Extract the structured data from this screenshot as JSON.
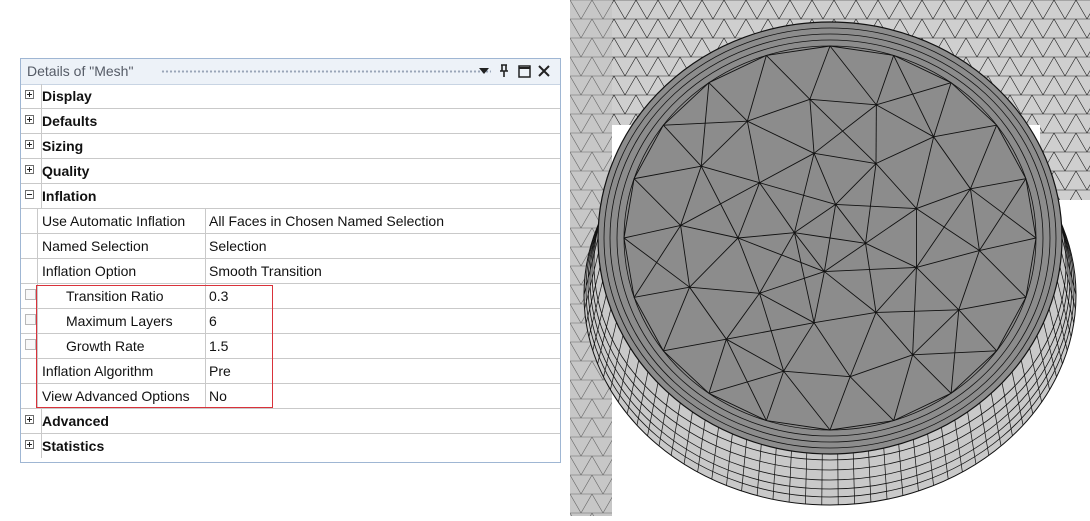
{
  "panel": {
    "title": "Details of \"Mesh\"",
    "header_buttons": [
      "dropdown-arrow-icon",
      "pin-icon",
      "maximize-icon",
      "close-icon"
    ],
    "groups_top": [
      {
        "label": "Display",
        "state": "collapsed"
      },
      {
        "label": "Defaults",
        "state": "collapsed"
      },
      {
        "label": "Sizing",
        "state": "collapsed"
      },
      {
        "label": "Quality",
        "state": "collapsed"
      }
    ],
    "inflation": {
      "label": "Inflation",
      "state": "expanded",
      "properties": [
        {
          "name": "Use Automatic Inflation",
          "value": "All Faces in Chosen Named Selection",
          "checkbox": false
        },
        {
          "name": "Named Selection",
          "value": "Selection",
          "checkbox": false
        },
        {
          "name": "Inflation Option",
          "value": "Smooth Transition",
          "checkbox": false
        },
        {
          "name": "Transition Ratio",
          "value": "0.3",
          "checkbox": true
        },
        {
          "name": "Maximum Layers",
          "value": "6",
          "checkbox": true
        },
        {
          "name": "Growth Rate",
          "value": "1.5",
          "checkbox": true
        },
        {
          "name": "Inflation Algorithm",
          "value": "Pre",
          "checkbox": false
        },
        {
          "name": "View Advanced Options",
          "value": "No",
          "checkbox": false
        }
      ]
    },
    "groups_bottom": [
      {
        "label": "Advanced",
        "state": "collapsed"
      },
      {
        "label": "Statistics",
        "state": "collapsed"
      }
    ]
  },
  "colors": {
    "panel_border": "#9fb6d3",
    "highlight_border": "#d9323a",
    "mesh_face": "#8c8c8c",
    "mesh_side": "#cfcfcf",
    "mesh_lines": "#111111"
  },
  "viewport": {
    "content": "mesh-preview"
  }
}
